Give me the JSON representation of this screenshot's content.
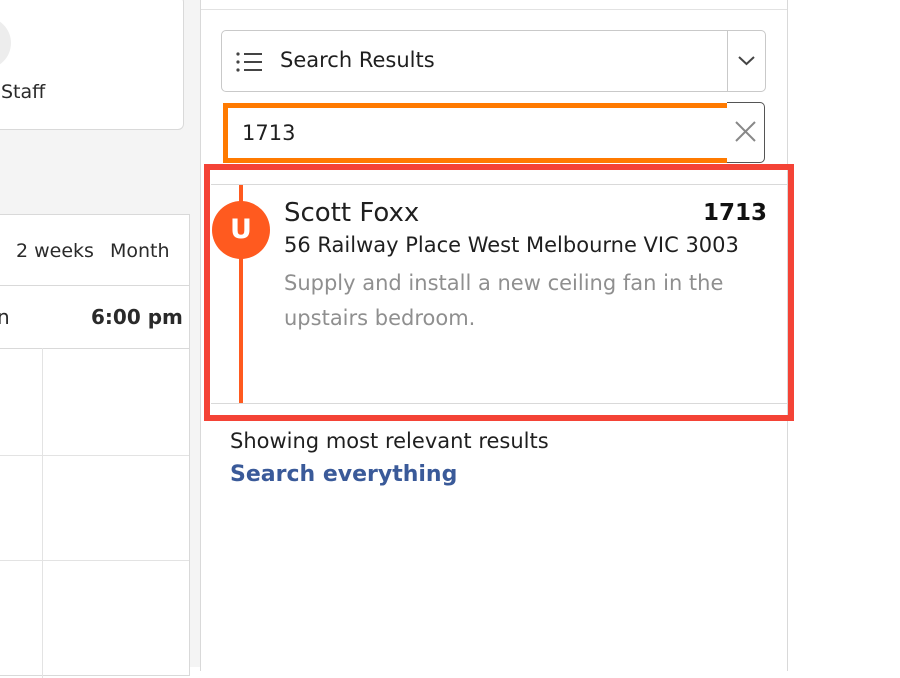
{
  "staff": {
    "label": "Staff"
  },
  "calendar": {
    "views": [
      "2 weeks",
      "Month"
    ],
    "time_partial": "n",
    "time_label": "6:00 pm"
  },
  "search": {
    "mode_label": "Search Results",
    "query": "1713"
  },
  "results": [
    {
      "status_letter": "U",
      "client": "Scott Foxx",
      "job_number": "1713",
      "address": "56 Railway Place West Melbourne VIC 3003",
      "description": "Supply and install a new ceiling fan in the upstairs bedroom."
    }
  ],
  "footer": {
    "showing_text": "Showing most relevant results",
    "search_everything_label": "Search everything"
  },
  "colors": {
    "highlight_input": "#ff7a00",
    "highlight_result": "#f44336",
    "status_unscheduled": "#ff5a1f",
    "link": "#3a5a99"
  }
}
